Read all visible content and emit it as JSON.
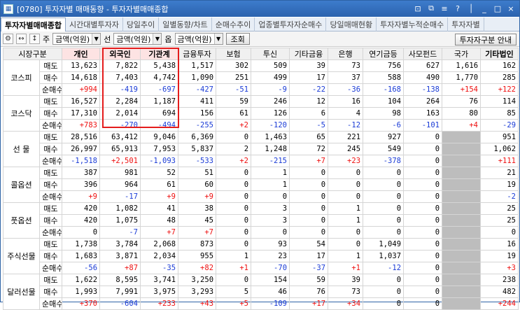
{
  "window": {
    "title": "[0780] 투자자별 매매동향 - 투자자별매매종합",
    "controls": [
      "⊡",
      "⧉",
      "≡",
      "?",
      "│",
      "_",
      "□",
      "×"
    ]
  },
  "tabs": [
    "투자자별매매종합",
    "시간대별투자자",
    "당일추이",
    "일별동향/차트",
    "순매수추이",
    "업종별투자자순매수",
    "당일매매현황",
    "투자자별누적순매수",
    "투자자별"
  ],
  "toolbar": {
    "gear": "⚙",
    "arrows": "↔",
    "updown": "↕",
    "label1": "주",
    "sel1": "금액(억원)",
    "label2": "선",
    "sel2": "금액(억원)",
    "label3": "옵",
    "sel3": "금액(억원)",
    "query": "조회",
    "guide": "투자자구분 안내"
  },
  "headers": [
    "시장구분",
    "",
    "개인",
    "외국인",
    "기관계",
    "금융투자",
    "보험",
    "투신",
    "기타금융",
    "은행",
    "연기금등",
    "사모펀드",
    "국가",
    "기타법인"
  ],
  "groups": [
    {
      "name": "코스피",
      "rows": [
        {
          "kind": "매도",
          "vals": [
            "13,623",
            "7,822",
            "5,438",
            "1,517",
            "302",
            "509",
            "39",
            "73",
            "756",
            "627",
            "1,616",
            "162"
          ]
        },
        {
          "kind": "매수",
          "vals": [
            "14,618",
            "7,403",
            "4,742",
            "1,090",
            "251",
            "499",
            "17",
            "37",
            "588",
            "490",
            "1,770",
            "285"
          ]
        },
        {
          "kind": "순매수",
          "vals": [
            "+994",
            "-419",
            "-697",
            "-427",
            "-51",
            "-9",
            "-22",
            "-36",
            "-168",
            "-138",
            "+154",
            "+122"
          ]
        }
      ]
    },
    {
      "name": "코스닥",
      "rows": [
        {
          "kind": "매도",
          "vals": [
            "16,527",
            "2,284",
            "1,187",
            "411",
            "59",
            "246",
            "12",
            "16",
            "104",
            "264",
            "76",
            "114"
          ]
        },
        {
          "kind": "매수",
          "vals": [
            "17,310",
            "2,014",
            "694",
            "156",
            "61",
            "126",
            "6",
            "4",
            "98",
            "163",
            "80",
            "85"
          ]
        },
        {
          "kind": "순매수",
          "vals": [
            "+783",
            "-270",
            "-494",
            "-255",
            "+2",
            "-120",
            "-5",
            "-12",
            "-6",
            "-101",
            "+4",
            "-29"
          ]
        }
      ]
    },
    {
      "name": "선 물",
      "rows": [
        {
          "kind": "매도",
          "vals": [
            "28,516",
            "63,412",
            "9,046",
            "6,369",
            "0",
            "1,463",
            "65",
            "221",
            "927",
            "0",
            "",
            "951"
          ]
        },
        {
          "kind": "매수",
          "vals": [
            "26,997",
            "65,913",
            "7,953",
            "5,837",
            "2",
            "1,248",
            "72",
            "245",
            "549",
            "0",
            "",
            "1,062"
          ]
        },
        {
          "kind": "순매수",
          "vals": [
            "-1,518",
            "+2,501",
            "-1,093",
            "-533",
            "+2",
            "-215",
            "+7",
            "+23",
            "-378",
            "0",
            "",
            "+111"
          ]
        }
      ]
    },
    {
      "name": "콜옵션",
      "rows": [
        {
          "kind": "매도",
          "vals": [
            "387",
            "981",
            "52",
            "51",
            "0",
            "1",
            "0",
            "0",
            "0",
            "0",
            "",
            "21"
          ]
        },
        {
          "kind": "매수",
          "vals": [
            "396",
            "964",
            "61",
            "60",
            "0",
            "1",
            "0",
            "0",
            "0",
            "0",
            "",
            "19"
          ]
        },
        {
          "kind": "순매수",
          "vals": [
            "+9",
            "-17",
            "+9",
            "+9",
            "0",
            "0",
            "0",
            "0",
            "0",
            "0",
            "",
            "-2"
          ]
        }
      ]
    },
    {
      "name": "풋옵션",
      "rows": [
        {
          "kind": "매도",
          "vals": [
            "420",
            "1,082",
            "41",
            "38",
            "0",
            "3",
            "0",
            "1",
            "0",
            "0",
            "",
            "25"
          ]
        },
        {
          "kind": "매수",
          "vals": [
            "420",
            "1,075",
            "48",
            "45",
            "0",
            "3",
            "0",
            "1",
            "0",
            "0",
            "",
            "25"
          ]
        },
        {
          "kind": "순매수",
          "vals": [
            "0",
            "-7",
            "+7",
            "+7",
            "0",
            "0",
            "0",
            "0",
            "0",
            "0",
            "",
            "0"
          ]
        }
      ]
    },
    {
      "name": "주식선물",
      "rows": [
        {
          "kind": "매도",
          "vals": [
            "1,738",
            "3,784",
            "2,068",
            "873",
            "0",
            "93",
            "54",
            "0",
            "1,049",
            "0",
            "",
            "16"
          ]
        },
        {
          "kind": "매수",
          "vals": [
            "1,683",
            "3,871",
            "2,034",
            "955",
            "1",
            "23",
            "17",
            "1",
            "1,037",
            "0",
            "",
            "19"
          ]
        },
        {
          "kind": "순매수",
          "vals": [
            "-56",
            "+87",
            "-35",
            "+82",
            "+1",
            "-70",
            "-37",
            "+1",
            "-12",
            "0",
            "",
            "+3"
          ]
        }
      ]
    },
    {
      "name": "달러선물",
      "rows": [
        {
          "kind": "매도",
          "vals": [
            "1,622",
            "8,595",
            "3,741",
            "3,250",
            "0",
            "154",
            "59",
            "39",
            "0",
            "0",
            "",
            "238"
          ]
        },
        {
          "kind": "매수",
          "vals": [
            "1,993",
            "7,991",
            "3,975",
            "3,293",
            "5",
            "46",
            "76",
            "73",
            "0",
            "0",
            "",
            "482"
          ]
        },
        {
          "kind": "순매수",
          "vals": [
            "+370",
            "-604",
            "+233",
            "+43",
            "+5",
            "-109",
            "+17",
            "+34",
            "0",
            "0",
            "",
            "+244"
          ]
        }
      ]
    }
  ]
}
